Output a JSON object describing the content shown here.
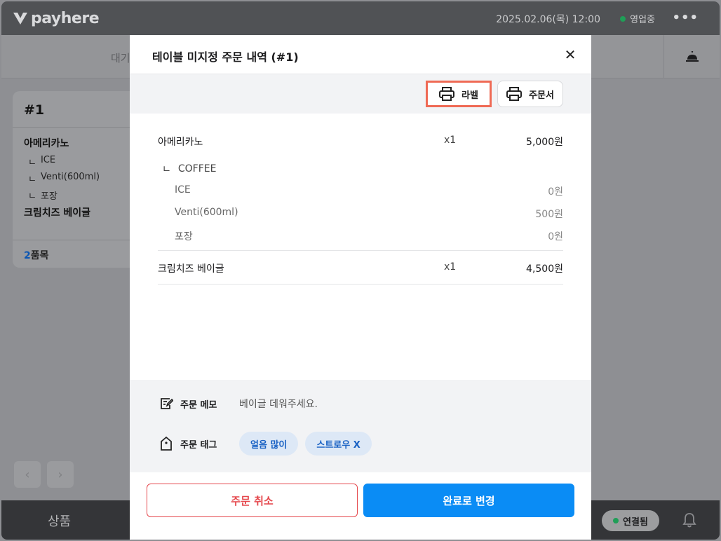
{
  "topbar": {
    "logo_text": "payhere",
    "datetime": "2025.02.06(목) 12:00",
    "status_label": "영업중"
  },
  "tabbar": {
    "partial_tab": "대기"
  },
  "order_card": {
    "number": "#1",
    "items": [
      {
        "name": "아메리카노"
      },
      {
        "name": "크림치즈 베이글"
      }
    ],
    "sub_prefix": "ㄴ",
    "options": [
      "ICE",
      "Venti(600ml)",
      "포장"
    ],
    "count_num": "2",
    "count_unit": "품목"
  },
  "bottombar": {
    "product_tab": "상품",
    "connection_label": "연결됨"
  },
  "modal": {
    "title": "테이블 미지정 주문 내역 (#1)",
    "label_button": "라벨",
    "order_sheet_button": "주문서",
    "items": [
      {
        "name": "아메리카노",
        "qty": "x1",
        "price": "5,000원",
        "category": "COFFEE",
        "options": [
          {
            "name": "ICE",
            "price": "0원"
          },
          {
            "name": "Venti(600ml)",
            "price": "500원"
          },
          {
            "name": "포장",
            "price": "0원"
          }
        ]
      },
      {
        "name": "크림치즈 베이글",
        "qty": "x1",
        "price": "4,500원"
      }
    ],
    "category_prefix": "ㄴ",
    "memo_label": "주문 메모",
    "memo_text": "베이글 데워주세요.",
    "tag_label": "주문 태그",
    "tags": [
      "얼음 많이",
      "스트로우 X"
    ],
    "cancel_button": "주문 취소",
    "complete_button": "완료로 변경"
  },
  "colors": {
    "accent": "#0a8cf5",
    "danger": "#e5484d",
    "highlight": "#ef6a55",
    "status_green": "#1f9e57"
  }
}
